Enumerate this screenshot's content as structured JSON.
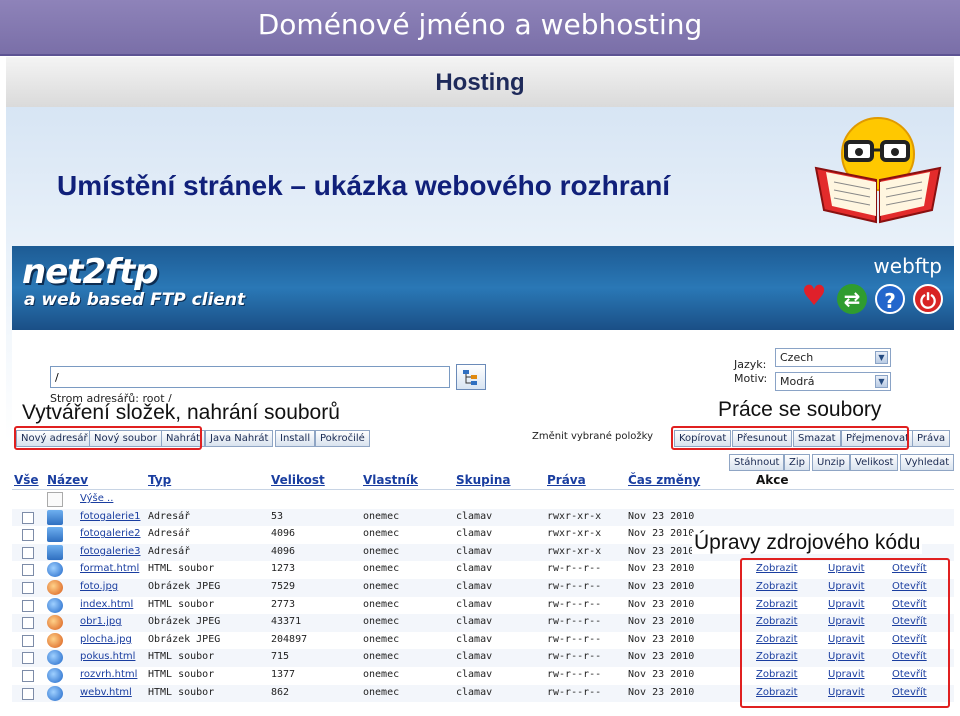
{
  "slide": {
    "title": "Doménové jméno a webhosting",
    "subtitle": "Hosting",
    "heading": "Umístění stránek – ukázka webového rozhraní"
  },
  "banner": {
    "logo": "net2ftp",
    "tagline": "a web based FTP client",
    "brand": "webftp",
    "icons": [
      "heart-icon",
      "refresh-icon",
      "help-icon",
      "power-icon"
    ]
  },
  "toolbar": {
    "path_value": "/",
    "tree_label": "Strom adresářů: root /",
    "language_label": "Jazyk:",
    "language_value": "Czech",
    "theme_label": "Motiv:",
    "theme_value": "Modrá",
    "left_buttons": [
      "Nový adresář",
      "Nový soubor",
      "Nahrát",
      "Java Nahrát",
      "Install",
      "Pokročilé"
    ],
    "change_label": "Změnit vybrané položky",
    "right_buttons_row1": [
      "Kopírovat",
      "Přesunout",
      "Smazat",
      "Přejmenovat",
      "Práva"
    ],
    "right_buttons_row2": [
      "Stáhnout",
      "Zip",
      "Unzip",
      "Velikost",
      "Vyhledat"
    ]
  },
  "annotations": {
    "left": "Vytváření složek, nahrání souborů",
    "right": "Práce se soubory",
    "code": "Úpravy zdrojového kódu"
  },
  "table": {
    "headers": [
      "Vše",
      "Název",
      "Typ",
      "Velikost",
      "Vlastník",
      "Skupina",
      "Práva",
      "Čas změny",
      "Akce"
    ],
    "updir": "Výše ..",
    "rows": [
      {
        "name": "fotogalerie1",
        "type": "Adresář",
        "size": "53",
        "owner": "onemec",
        "group": "clamav",
        "perms": "rwxr-xr-x",
        "date": "Nov 23 2010",
        "icon": "folder"
      },
      {
        "name": "fotogalerie2",
        "type": "Adresář",
        "size": "4096",
        "owner": "onemec",
        "group": "clamav",
        "perms": "rwxr-xr-x",
        "date": "Nov 23 2010",
        "icon": "folder"
      },
      {
        "name": "fotogalerie3",
        "type": "Adresář",
        "size": "4096",
        "owner": "onemec",
        "group": "clamav",
        "perms": "rwxr-xr-x",
        "date": "Nov 23 2010",
        "icon": "folder"
      },
      {
        "name": "format.html",
        "type": "HTML soubor",
        "size": "1273",
        "owner": "onemec",
        "group": "clamav",
        "perms": "rw-r--r--",
        "date": "Nov 23 2010",
        "icon": "ie"
      },
      {
        "name": "foto.jpg",
        "type": "Obrázek JPEG",
        "size": "7529",
        "owner": "onemec",
        "group": "clamav",
        "perms": "rw-r--r--",
        "date": "Nov 23 2010",
        "icon": "img"
      },
      {
        "name": "index.html",
        "type": "HTML soubor",
        "size": "2773",
        "owner": "onemec",
        "group": "clamav",
        "perms": "rw-r--r--",
        "date": "Nov 23 2010",
        "icon": "ie"
      },
      {
        "name": "obr1.jpg",
        "type": "Obrázek JPEG",
        "size": "43371",
        "owner": "onemec",
        "group": "clamav",
        "perms": "rw-r--r--",
        "date": "Nov 23 2010",
        "icon": "img"
      },
      {
        "name": "plocha.jpg",
        "type": "Obrázek JPEG",
        "size": "204897",
        "owner": "onemec",
        "group": "clamav",
        "perms": "rw-r--r--",
        "date": "Nov 23 2010",
        "icon": "img"
      },
      {
        "name": "pokus.html",
        "type": "HTML soubor",
        "size": "715",
        "owner": "onemec",
        "group": "clamav",
        "perms": "rw-r--r--",
        "date": "Nov 23 2010",
        "icon": "ie"
      },
      {
        "name": "rozvrh.html",
        "type": "HTML soubor",
        "size": "1377",
        "owner": "onemec",
        "group": "clamav",
        "perms": "rw-r--r--",
        "date": "Nov 23 2010",
        "icon": "ie"
      },
      {
        "name": "webv.html",
        "type": "HTML soubor",
        "size": "862",
        "owner": "onemec",
        "group": "clamav",
        "perms": "rw-r--r--",
        "date": "Nov 23 2010",
        "icon": "ie"
      }
    ],
    "actions": [
      "Zobrazit",
      "Upravit",
      "Otevřít"
    ]
  },
  "colors": {
    "header": "#7a6fa8",
    "heading": "#10207a",
    "banner": "#2a78b6",
    "highlight": "#e02020",
    "link": "#1a3ea0"
  }
}
